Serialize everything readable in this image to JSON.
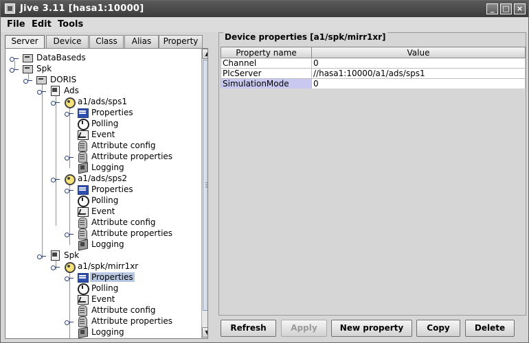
{
  "window": {
    "title": "Jive 3.11  [hasa1:10000]",
    "min_glyph": "_",
    "max_glyph": "□",
    "close_glyph": "×"
  },
  "menubar": {
    "items": [
      "File",
      "Edit",
      "Tools"
    ]
  },
  "tabs": [
    {
      "label": "Server",
      "active": true
    },
    {
      "label": "Device",
      "active": false
    },
    {
      "label": "Class",
      "active": false
    },
    {
      "label": "Alias",
      "active": false
    },
    {
      "label": "Property",
      "active": false
    }
  ],
  "tree": {
    "rows": [
      {
        "label": "DataBaseds",
        "icon": "server-icon"
      },
      {
        "label": "Spk",
        "icon": "server-icon"
      },
      {
        "label": "DORIS",
        "icon": "server-icon"
      },
      {
        "label": "Ads",
        "icon": "class-icon"
      },
      {
        "label": "a1/ads/sps1",
        "icon": "device-icon"
      },
      {
        "label": "Properties",
        "icon": "properties-icon"
      },
      {
        "label": "Polling",
        "icon": "polling-icon"
      },
      {
        "label": "Event",
        "icon": "event-icon"
      },
      {
        "label": "Attribute config",
        "icon": "attribute-icon"
      },
      {
        "label": "Attribute properties",
        "icon": "attribute-icon"
      },
      {
        "label": "Logging",
        "icon": "logging-icon"
      },
      {
        "label": "a1/ads/sps2",
        "icon": "device-icon"
      },
      {
        "label": "Properties",
        "icon": "properties-icon"
      },
      {
        "label": "Polling",
        "icon": "polling-icon"
      },
      {
        "label": "Event",
        "icon": "event-icon"
      },
      {
        "label": "Attribute config",
        "icon": "attribute-icon"
      },
      {
        "label": "Attribute properties",
        "icon": "attribute-icon"
      },
      {
        "label": "Logging",
        "icon": "logging-icon"
      },
      {
        "label": "Spk",
        "icon": "class-icon"
      },
      {
        "label": "a1/spk/mirr1xr",
        "icon": "device-icon"
      },
      {
        "label": "Properties",
        "icon": "properties-icon",
        "selected": true
      },
      {
        "label": "Polling",
        "icon": "polling-icon"
      },
      {
        "label": "Event",
        "icon": "event-icon"
      },
      {
        "label": "Attribute config",
        "icon": "attribute-icon"
      },
      {
        "label": "Attribute properties",
        "icon": "attribute-icon"
      },
      {
        "label": "Logging",
        "icon": "logging-icon"
      }
    ]
  },
  "scrollbar": {
    "up_glyph": "▲",
    "down_glyph": "▼"
  },
  "properties": {
    "group_title": "Device properties [a1/spk/mirr1xr]",
    "columns": [
      "Property name",
      "Value"
    ],
    "rows": [
      {
        "name": "Channel",
        "value": "0"
      },
      {
        "name": "PlcServer",
        "value": "//hasa1:10000/a1/ads/sps1"
      },
      {
        "name": "SimulationMode",
        "value": "0"
      }
    ]
  },
  "buttons": {
    "refresh": "Refresh",
    "apply": "Apply",
    "new_property": "New property",
    "copy": "Copy",
    "delete": "Delete"
  }
}
